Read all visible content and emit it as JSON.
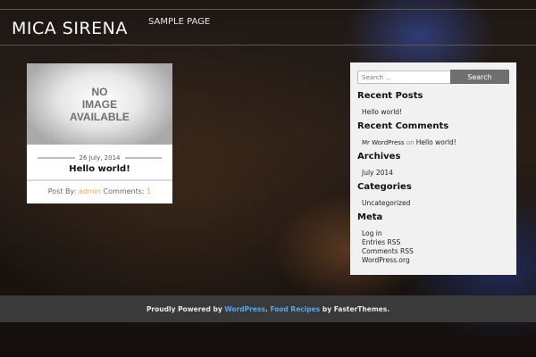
{
  "header": {
    "site_title": "MICA SIRENA",
    "nav": [
      {
        "label": "SAMPLE PAGE"
      }
    ]
  },
  "post": {
    "thumbnail_text": [
      "NO",
      "IMAGE",
      "AVAILABLE"
    ],
    "date": "26 July, 2014",
    "title": "Hello world!",
    "meta": {
      "posted_by_label": "Post By:",
      "author": "admin",
      "comments_label": "Comments:",
      "comments_count": "1"
    }
  },
  "sidebar": {
    "search": {
      "placeholder": "Search ...",
      "button_label": "Search"
    },
    "recent_posts": {
      "title": "Recent Posts",
      "items": [
        "Hello world!"
      ]
    },
    "recent_comments": {
      "title": "Recent Comments",
      "items": [
        {
          "author": "Mr WordPress",
          "on": "on",
          "post": "Hello world!"
        }
      ]
    },
    "archives": {
      "title": "Archives",
      "items": [
        "July 2014"
      ]
    },
    "categories": {
      "title": "Categories",
      "items": [
        "Uncategorized"
      ]
    },
    "meta": {
      "title": "Meta",
      "items": [
        "Log in",
        "Entries RSS",
        "Comments RSS",
        "WordPress.org"
      ]
    }
  },
  "footer": {
    "prefix": "Proudly Powered by",
    "wordpress": "WordPress",
    "sep": ".",
    "theme": "Food Recipes",
    "by": "by FasterThemes."
  },
  "colors": {
    "accent": "#f3a64e",
    "footer_link": "#5aa4e6",
    "footer_bg": "#3a3a3a",
    "sidebar_bg": "#f1f1f1"
  }
}
